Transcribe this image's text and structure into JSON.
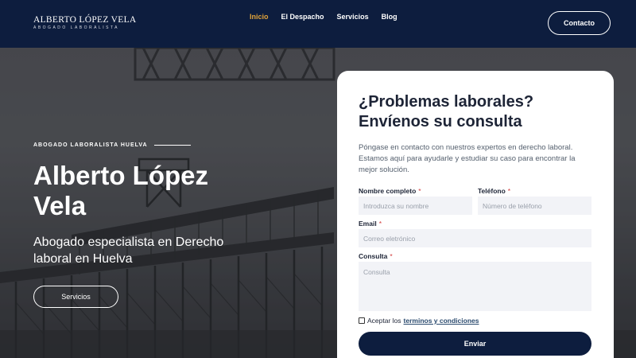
{
  "header": {
    "logo_name": "ALBERTO LÓPEZ VELA",
    "logo_sub": "ABOGADO LABORALISTA",
    "nav": [
      {
        "label": "Inicio",
        "active": true
      },
      {
        "label": "El Despacho",
        "active": false
      },
      {
        "label": "Servicios",
        "active": false
      },
      {
        "label": "Blog",
        "active": false
      }
    ],
    "contact_label": "Contacto"
  },
  "hero": {
    "eyebrow": "ABOGADO LABORALISTA HUELVA",
    "title": "Alberto López Vela",
    "subtitle": "Abogado especialista en Derecho laboral en Huelva",
    "button_label": "Servicios"
  },
  "form": {
    "title": "¿Problemas laborales? Envíenos su consulta",
    "description": "Póngase en contacto con nuestros expertos en derecho laboral. Estamos aquí para ayudarle y estudiar su caso para encontrar la mejor solución.",
    "name_label": "Nombre completo",
    "name_placeholder": "Introduzca su nombre",
    "phone_label": "Teléfono",
    "phone_placeholder": "Número de teléfono",
    "email_label": "Email",
    "email_placeholder": "Correo eletrónico",
    "message_label": "Consulta",
    "message_placeholder": "Consulta",
    "required_mark": "*",
    "accept_prefix": "Aceptar los",
    "terms_link": "terminos y condiciones",
    "submit_label": "Enviar"
  },
  "colors": {
    "header_bg": "#0d1d3e",
    "active_nav": "#e0a23a",
    "required": "#d23c3c"
  }
}
